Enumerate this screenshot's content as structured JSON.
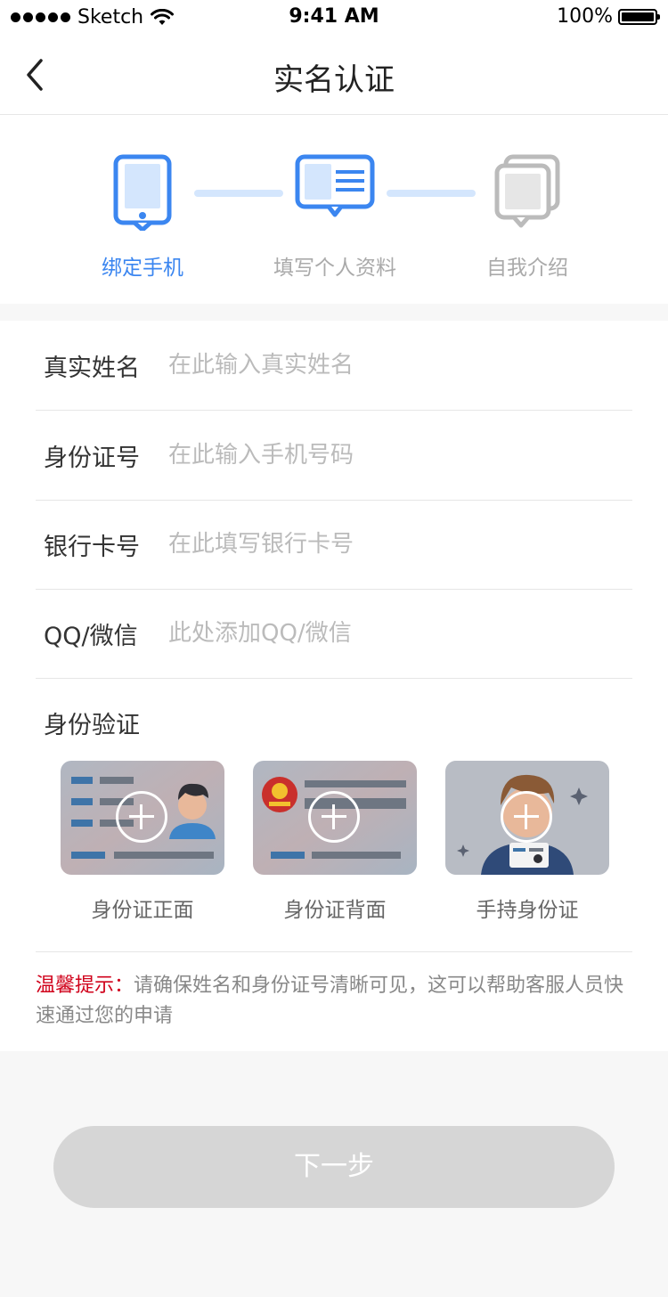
{
  "status_bar": {
    "carrier": "Sketch",
    "time": "9:41 AM",
    "battery": "100%"
  },
  "nav": {
    "title": "实名认证",
    "back_icon": "chevron-left-icon"
  },
  "steps": [
    {
      "label": "绑定手机",
      "icon": "phone-icon",
      "active": true
    },
    {
      "label": "填写个人资料",
      "icon": "id-card-icon",
      "active": false
    },
    {
      "label": "自我介绍",
      "icon": "stack-cards-icon",
      "active": false
    }
  ],
  "form": {
    "fields": [
      {
        "label": "真实姓名",
        "placeholder": "在此输入真实姓名"
      },
      {
        "label": "身份证号",
        "placeholder": "在此输入手机号码"
      },
      {
        "label": "银行卡号",
        "placeholder": "在此填写银行卡号"
      },
      {
        "label": "QQ/微信",
        "placeholder": "此处添加QQ/微信"
      }
    ],
    "verify_title": "身份验证",
    "uploads": [
      {
        "caption": "身份证正面"
      },
      {
        "caption": "身份证背面"
      },
      {
        "caption": "手持身份证"
      }
    ],
    "tip_label": "温馨提示：",
    "tip_text": "请确保姓名和身份证号清晰可见，这可以帮助客服人员快速通过您的申请"
  },
  "next_button": "下一步",
  "colors": {
    "accent": "#3b86f0",
    "step_connector": "#d4e6fd",
    "inactive": "#aaaaaa",
    "tip_label": "#d0021b",
    "button_disabled": "#d6d6d6"
  }
}
